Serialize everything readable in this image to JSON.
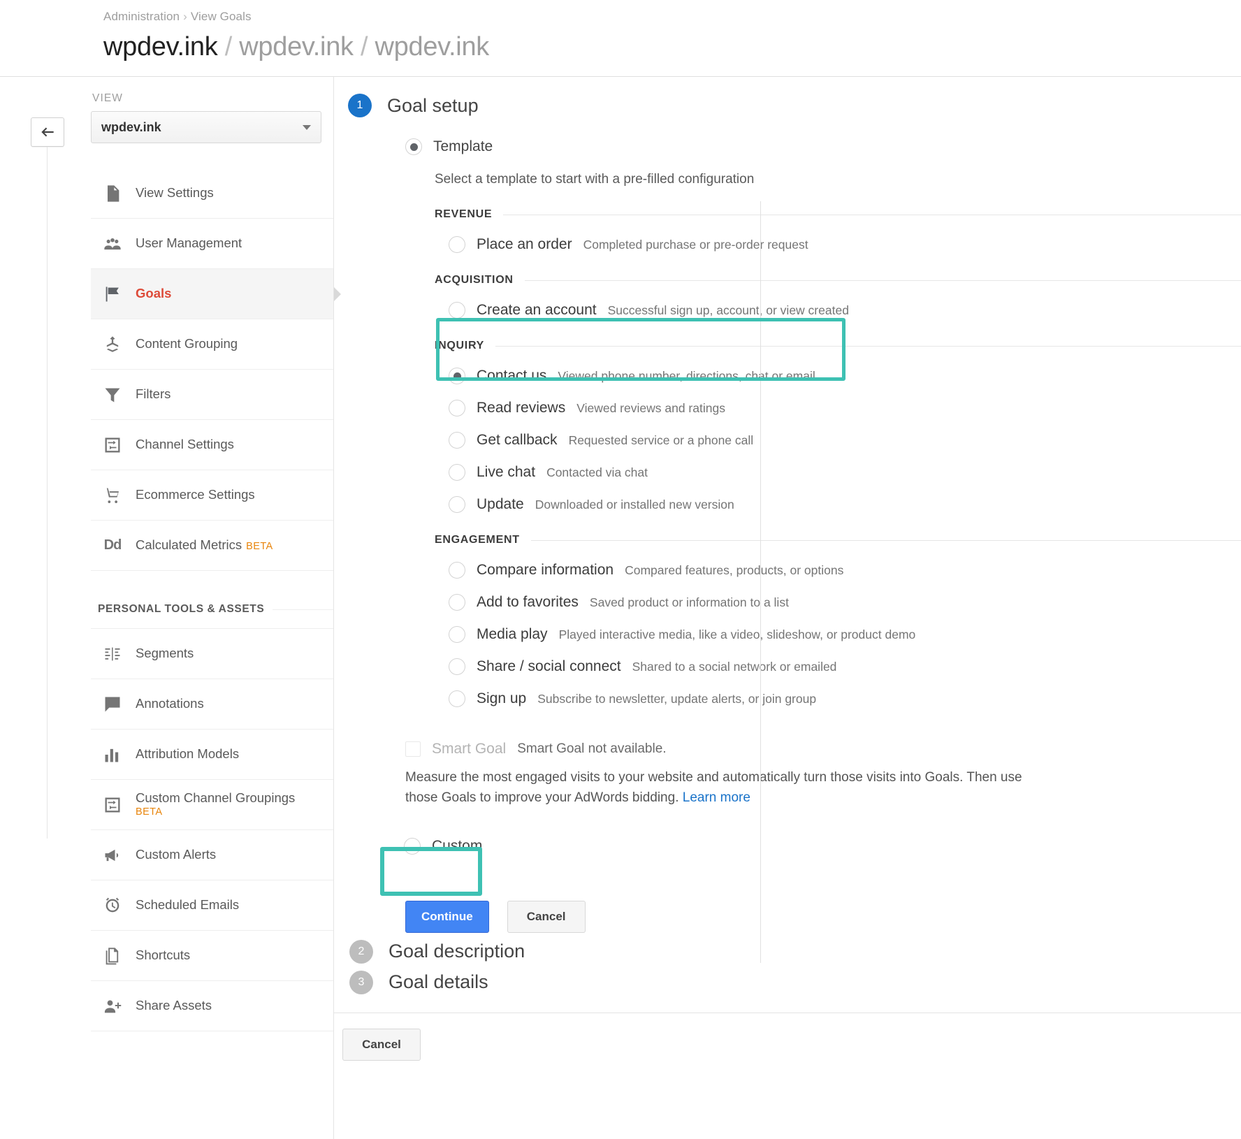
{
  "header": {
    "breadcrumb_root": "Administration",
    "breadcrumb_sep": "›",
    "breadcrumb_current": "View Goals",
    "title_account": "wpdev.ink",
    "title_property": "wpdev.ink",
    "title_view": "wpdev.ink",
    "slash": "/"
  },
  "sidebar": {
    "view_label": "VIEW",
    "view_value": "wpdev.ink",
    "items": [
      {
        "label": "View Settings",
        "icon": "document-icon",
        "active": false
      },
      {
        "label": "User Management",
        "icon": "users-icon",
        "active": false
      },
      {
        "label": "Goals",
        "icon": "flag-icon",
        "active": true
      },
      {
        "label": "Content Grouping",
        "icon": "content-grouping-icon",
        "active": false
      },
      {
        "label": "Filters",
        "icon": "funnel-icon",
        "active": false
      },
      {
        "label": "Channel Settings",
        "icon": "channel-settings-icon",
        "active": false
      },
      {
        "label": "Ecommerce Settings",
        "icon": "cart-icon",
        "active": false
      },
      {
        "label": "Calculated Metrics",
        "icon": "dd-icon",
        "badge": "BETA",
        "active": false
      }
    ],
    "personal_section_title": "PERSONAL TOOLS & ASSETS",
    "personal_items": [
      {
        "label": "Segments",
        "icon": "segments-icon"
      },
      {
        "label": "Annotations",
        "icon": "annotation-icon"
      },
      {
        "label": "Attribution Models",
        "icon": "bar-chart-icon"
      },
      {
        "label": "Custom Channel Groupings",
        "icon": "channel-settings-icon",
        "badge": "BETA"
      },
      {
        "label": "Custom Alerts",
        "icon": "megaphone-icon"
      },
      {
        "label": "Scheduled Emails",
        "icon": "alarm-clock-icon"
      },
      {
        "label": "Shortcuts",
        "icon": "pages-icon"
      },
      {
        "label": "Share Assets",
        "icon": "share-user-icon"
      }
    ]
  },
  "main": {
    "step1": {
      "number": "1",
      "title": "Goal setup",
      "template_option": "Template",
      "hint": "Select a template to start with a pre-filled configuration",
      "groups": [
        {
          "title": "REVENUE",
          "options": [
            {
              "label": "Place an order",
              "desc": "Completed purchase or pre-order request",
              "selected": false
            }
          ]
        },
        {
          "title": "ACQUISITION",
          "options": [
            {
              "label": "Create an account",
              "desc": "Successful sign up, account, or view created",
              "selected": false
            }
          ]
        },
        {
          "title": "INQUIRY",
          "highlighted": true,
          "options": [
            {
              "label": "Contact us",
              "desc": "Viewed phone number, directions, chat or email",
              "selected": true
            },
            {
              "label": "Read reviews",
              "desc": "Viewed reviews and ratings",
              "selected": false
            },
            {
              "label": "Get callback",
              "desc": "Requested service or a phone call",
              "selected": false
            },
            {
              "label": "Live chat",
              "desc": "Contacted via chat",
              "selected": false
            },
            {
              "label": "Update",
              "desc": "Downloaded or installed new version",
              "selected": false
            }
          ]
        },
        {
          "title": "ENGAGEMENT",
          "options": [
            {
              "label": "Compare information",
              "desc": "Compared features, products, or options",
              "selected": false
            },
            {
              "label": "Add to favorites",
              "desc": "Saved product or information to a list",
              "selected": false
            },
            {
              "label": "Media play",
              "desc": "Played interactive media, like a video, slideshow, or product demo",
              "selected": false
            },
            {
              "label": "Share / social connect",
              "desc": "Shared to a social network or emailed",
              "selected": false
            },
            {
              "label": "Sign up",
              "desc": "Subscribe to newsletter, update alerts, or join group",
              "selected": false
            }
          ]
        }
      ],
      "smart_goal": {
        "label": "Smart Goal",
        "status": "Smart Goal not available.",
        "description": "Measure the most engaged visits to your website and automatically turn those visits into Goals. Then use those Goals to improve your AdWords bidding.",
        "link": "Learn more"
      },
      "custom_option": "Custom",
      "continue_button": "Continue",
      "cancel_button": "Cancel"
    },
    "step2": {
      "number": "2",
      "title": "Goal description"
    },
    "step3": {
      "number": "3",
      "title": "Goal details"
    },
    "bottom_cancel": "Cancel"
  },
  "colors": {
    "accent_blue": "#4285f4",
    "highlight_teal": "#3ec1b3",
    "active_red": "#dd4b39",
    "beta_orange": "#e8850c"
  }
}
